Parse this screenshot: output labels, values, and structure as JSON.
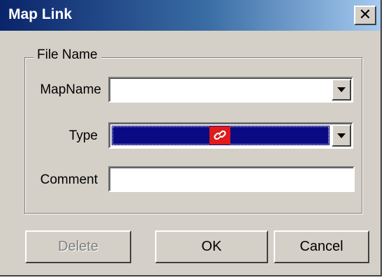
{
  "window": {
    "title": "Map Link",
    "close_glyph": "✕"
  },
  "group": {
    "legend": "File Name"
  },
  "fields": {
    "mapname_label": "MapName",
    "mapname_value": "",
    "type_label": "Type",
    "type_icon": "link-icon",
    "comment_label": "Comment",
    "comment_value": ""
  },
  "buttons": {
    "delete": "Delete",
    "ok": "OK",
    "cancel": "Cancel"
  },
  "colors": {
    "title_start": "#0a246a",
    "title_end": "#a6caf0",
    "selection": "#0a0a84",
    "icon_bg": "#e11a1a",
    "face": "#d4d0c8"
  }
}
